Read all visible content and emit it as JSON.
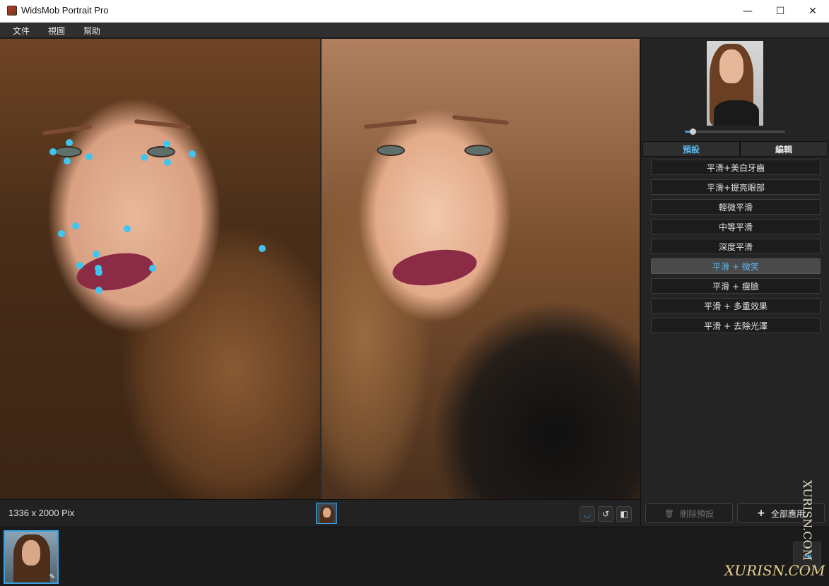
{
  "window": {
    "title": "WidsMob Portrait Pro",
    "controls": {
      "minimize": "—",
      "maximize": "☐",
      "close": "✕"
    }
  },
  "menu": {
    "items": [
      {
        "label": "文件"
      },
      {
        "label": "視圖"
      },
      {
        "label": "幫助"
      }
    ]
  },
  "panel": {
    "tabs": [
      {
        "label": "預設",
        "active": true
      },
      {
        "label": "編輯",
        "active": false
      }
    ],
    "zoom_level": 0.08,
    "presets": [
      {
        "label": "平滑+美白牙齒",
        "active": false
      },
      {
        "label": "平滑+提亮眼部",
        "active": false
      },
      {
        "label": "輕微平滑",
        "active": false
      },
      {
        "label": "中等平滑",
        "active": false
      },
      {
        "label": "深度平滑",
        "active": false
      },
      {
        "label": "平滑 + 微笑",
        "active": true
      },
      {
        "label": "平滑 + 瘦臉",
        "active": false
      },
      {
        "label": "平滑 + 多重效果",
        "active": false
      },
      {
        "label": "平滑 + 去除光澤",
        "active": false
      }
    ],
    "delete_preset": {
      "label": "刪除預設",
      "icon": "trash-icon",
      "enabled": false
    },
    "apply_all": {
      "label": "全部應用",
      "icon": "plus-icon"
    }
  },
  "status": {
    "dimensions": "1336 x 2000 Pix"
  },
  "watermark": {
    "vertical": "XURISN.COM",
    "horizontal": "XURISN.COM"
  },
  "colors": {
    "accent": "#3aa0e0",
    "active_tab_text": "#5cb8f0",
    "landmark_dot": "#3ec6f0",
    "panel_bg": "#242424"
  }
}
